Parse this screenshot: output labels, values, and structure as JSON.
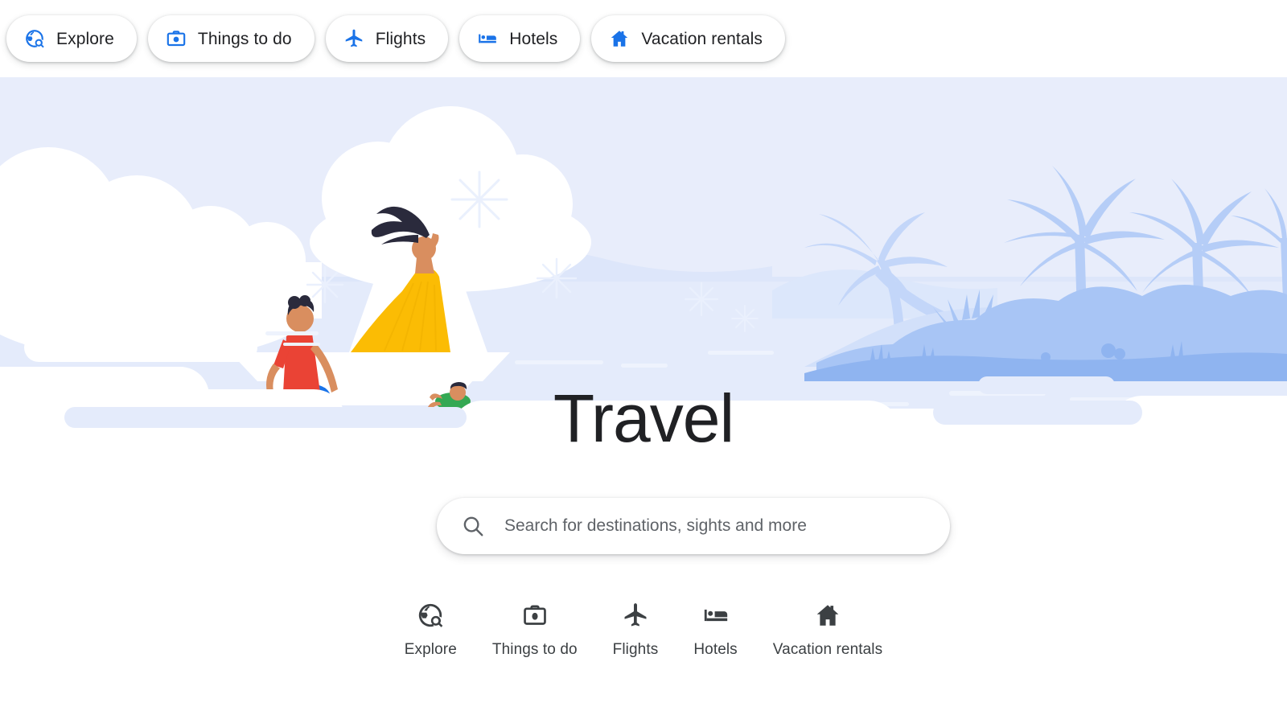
{
  "chip_bar": {
    "chips": [
      {
        "label": "Explore",
        "icon": "globe-search-icon"
      },
      {
        "label": "Things to do",
        "icon": "camera-icon"
      },
      {
        "label": "Flights",
        "icon": "airplane-icon"
      },
      {
        "label": "Hotels",
        "icon": "bed-icon"
      },
      {
        "label": "Vacation rentals",
        "icon": "house-icon"
      }
    ]
  },
  "hero": {
    "alt": "Illustration of a family sailing a boat past a tropical island with palm trees",
    "colors": {
      "sky": "#e8edfb",
      "sea": "#e3eafb",
      "cloud": "#ffffff",
      "island_light": "#c3d6f9",
      "island": "#a8c5f5",
      "island_dark": "#8fb4f0",
      "sail": "#ffffff",
      "dress_yellow": "#fbbc04",
      "shirt_red": "#ea4335",
      "shirt_green": "#34a853",
      "shorts_blue": "#1a73e8",
      "hair_dark": "#2a2a3c",
      "skin": "#e8a87c"
    }
  },
  "main": {
    "title": "Travel"
  },
  "search": {
    "placeholder": "Search for destinations, sights and more",
    "value": "",
    "icon": "search-icon"
  },
  "bottom_nav": {
    "items": [
      {
        "label": "Explore",
        "icon": "globe-search-icon"
      },
      {
        "label": "Things to do",
        "icon": "camera-icon"
      },
      {
        "label": "Flights",
        "icon": "airplane-icon"
      },
      {
        "label": "Hotels",
        "icon": "bed-icon"
      },
      {
        "label": "Vacation rentals",
        "icon": "house-icon"
      }
    ]
  },
  "theme": {
    "brand_blue": "#1a73e8",
    "text_primary": "#202124",
    "text_secondary": "#3c4043",
    "placeholder": "#5f6368",
    "page_bg": "#ffffff"
  }
}
